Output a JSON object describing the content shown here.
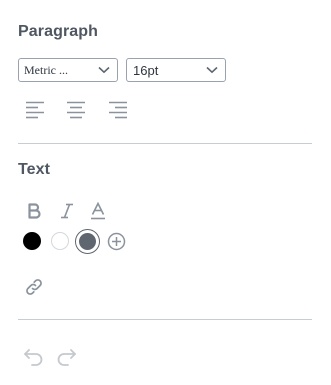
{
  "paragraph": {
    "heading": "Paragraph",
    "font_select": {
      "value": "Metric ...",
      "icon": "chevron-down-icon"
    },
    "size_select": {
      "value": "16pt",
      "icon": "chevron-down-icon"
    },
    "alignment_icons": [
      "align-left-icon",
      "align-center-icon",
      "align-right-icon"
    ]
  },
  "text": {
    "heading": "Text",
    "style_icons": [
      "bold-icon",
      "italic-icon",
      "text-color-icon"
    ],
    "swatches": [
      {
        "name": "black",
        "color": "#000000"
      },
      {
        "name": "white",
        "color": "#ffffff"
      },
      {
        "name": "slate-selected",
        "color": "#5f6670"
      }
    ],
    "add_color_icon": "add-color-icon",
    "link_icon": "link-icon"
  },
  "history": {
    "undo_icon": "undo-icon",
    "redo_icon": "redo-icon"
  },
  "colors": {
    "icon": "#8a939d",
    "disabled_icon": "#c4c9ce",
    "divider": "#c7cdd1"
  }
}
